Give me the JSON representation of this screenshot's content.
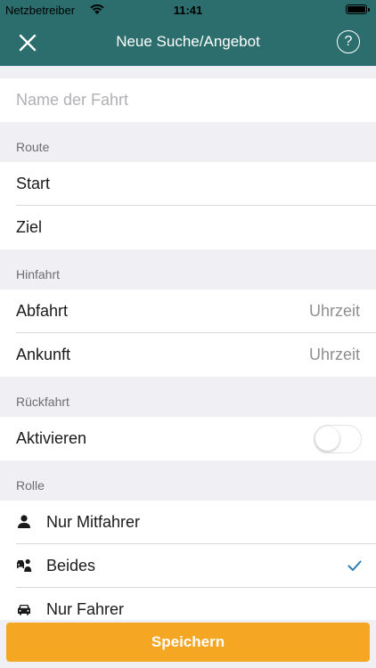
{
  "status_bar": {
    "carrier": "Netzbetreiber",
    "time": "11:41"
  },
  "header": {
    "title": "Neue Suche/Angebot",
    "help_label": "?"
  },
  "trip_name": {
    "placeholder": "Name der Fahrt",
    "value": ""
  },
  "route": {
    "section_label": "Route",
    "start_label": "Start",
    "destination_label": "Ziel"
  },
  "outbound": {
    "section_label": "Hinfahrt",
    "departure_label": "Abfahrt",
    "departure_value": "Uhrzeit",
    "arrival_label": "Ankunft",
    "arrival_value": "Uhrzeit"
  },
  "return_trip": {
    "section_label": "Rückfahrt",
    "activate_label": "Aktivieren",
    "activated": false
  },
  "role": {
    "section_label": "Rolle",
    "options": [
      {
        "label": "Nur Mitfahrer",
        "icon": "person-icon",
        "selected": false
      },
      {
        "label": "Beides",
        "icon": "driver-passenger-icon",
        "selected": true
      },
      {
        "label": "Nur Fahrer",
        "icon": "car-icon",
        "selected": false
      }
    ]
  },
  "save_button": {
    "label": "Speichern"
  },
  "colors": {
    "header": "#2b6e6d",
    "accent": "#f5a623",
    "check": "#2f7fb3"
  }
}
